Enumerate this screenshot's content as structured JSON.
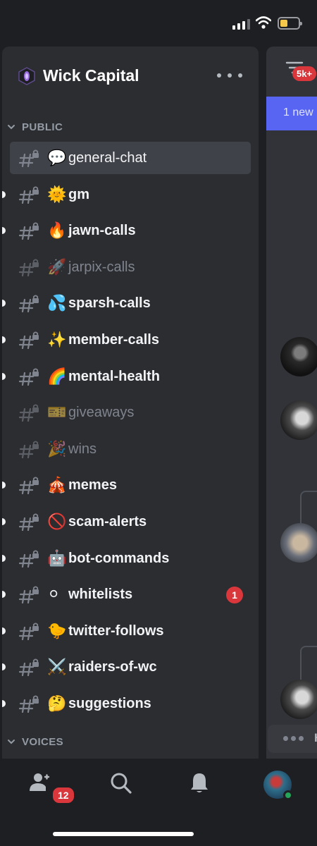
{
  "server": {
    "name": "Wick Capital"
  },
  "categories": {
    "public": "PUBLIC",
    "voices": "VOICES"
  },
  "channels": [
    {
      "emoji": "💬",
      "name": "general-chat",
      "state": "selected"
    },
    {
      "emoji": "🌞",
      "name": "gm",
      "state": "unread"
    },
    {
      "emoji": "🔥",
      "name": "jawn-calls",
      "state": "unread"
    },
    {
      "emoji": "🚀",
      "name": "jarpix-calls",
      "state": "muted"
    },
    {
      "emoji": "💦",
      "name": "sparsh-calls",
      "state": "unread"
    },
    {
      "emoji": "✨",
      "name": "member-calls",
      "state": "unread"
    },
    {
      "emoji": "🌈",
      "name": "mental-health",
      "state": "unread"
    },
    {
      "emoji": "🎫",
      "name": "giveaways",
      "state": "muted"
    },
    {
      "emoji": "🎉",
      "name": "wins",
      "state": "muted"
    },
    {
      "emoji": "🎪",
      "name": "memes",
      "state": "unread"
    },
    {
      "emoji": "🚫",
      "name": "scam-alerts",
      "state": "unread"
    },
    {
      "emoji": "🤖",
      "name": "bot-commands",
      "state": "unread"
    },
    {
      "emoji": "⚪",
      "name": "whitelists",
      "state": "unread",
      "mentions": "1"
    },
    {
      "emoji": "🐤",
      "name": "twitter-follows",
      "state": "unread"
    },
    {
      "emoji": "⚔️",
      "name": "raiders-of-wc",
      "state": "unread"
    },
    {
      "emoji": "🤔",
      "name": "suggestions",
      "state": "unread"
    }
  ],
  "peek": {
    "threads_badge": "5k+",
    "new_banner": "1 new",
    "typing_label": "H"
  },
  "bottom_nav": {
    "friends_badge": "12"
  },
  "colors": {
    "accent": "#5865f2",
    "badge": "#da373c",
    "online": "#23a55a",
    "battery": "#f5c84b"
  },
  "icons": {
    "server": "server-icon",
    "channel": "locked-hash-icon",
    "friends": "friends-icon",
    "search": "search-icon",
    "notifications": "bell-icon",
    "threads": "threads-icon"
  }
}
